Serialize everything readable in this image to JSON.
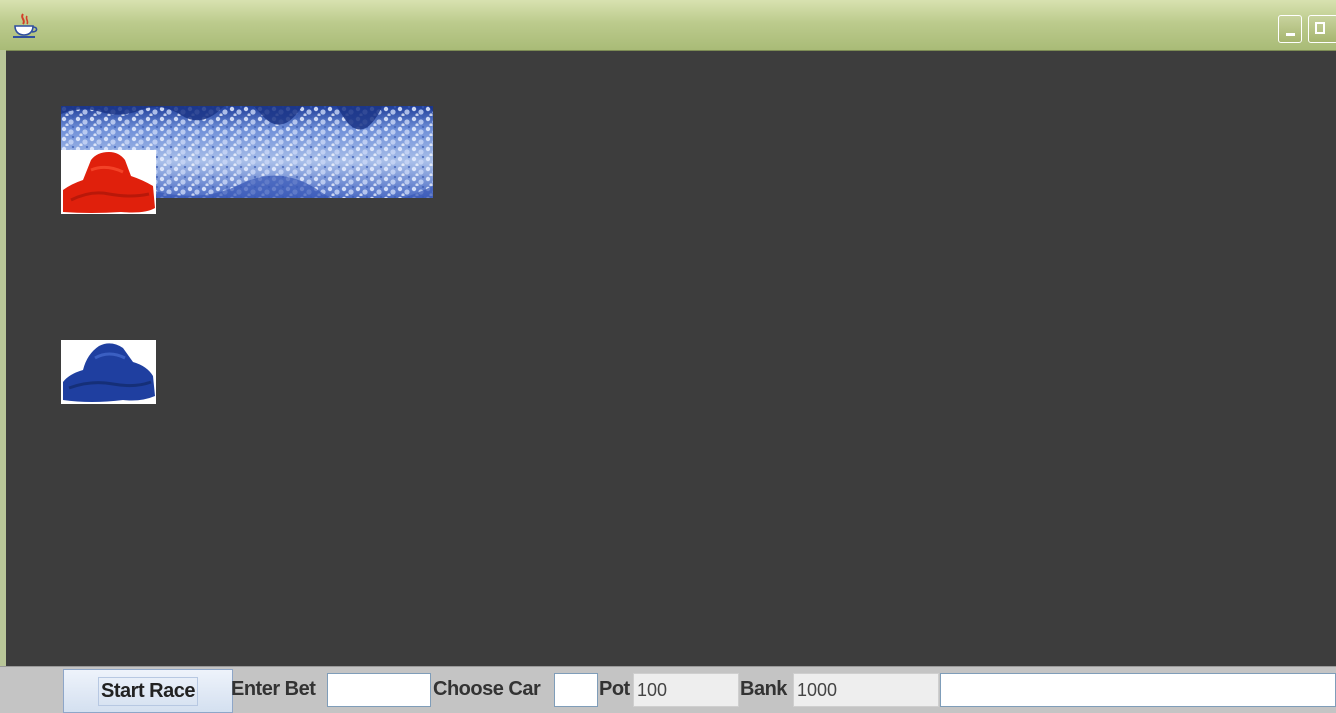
{
  "window": {
    "title": "",
    "icons": {
      "app": "java-coffee-icon",
      "minimize": "minimize-icon",
      "maximize": "maximize-icon"
    }
  },
  "race_area": {
    "background": "#3d3d3d",
    "track_image": "frosted-trees-image",
    "cars": [
      {
        "name": "red-car",
        "color": "#e0200c"
      },
      {
        "name": "blue-car",
        "color": "#1f3fa0"
      }
    ]
  },
  "controls": {
    "start_button_label": "Start Race",
    "enter_bet_label": "Enter Bet",
    "enter_bet_value": "",
    "choose_car_label": "Choose Car",
    "choose_car_value": "",
    "pot_label": "Pot",
    "pot_value": "100",
    "bank_label": "Bank",
    "bank_value": "1000",
    "status_value": ""
  },
  "colors": {
    "titlebar": "#bccb8d",
    "control_bar": "#c4c4c4",
    "button": "#d4e0f0"
  }
}
